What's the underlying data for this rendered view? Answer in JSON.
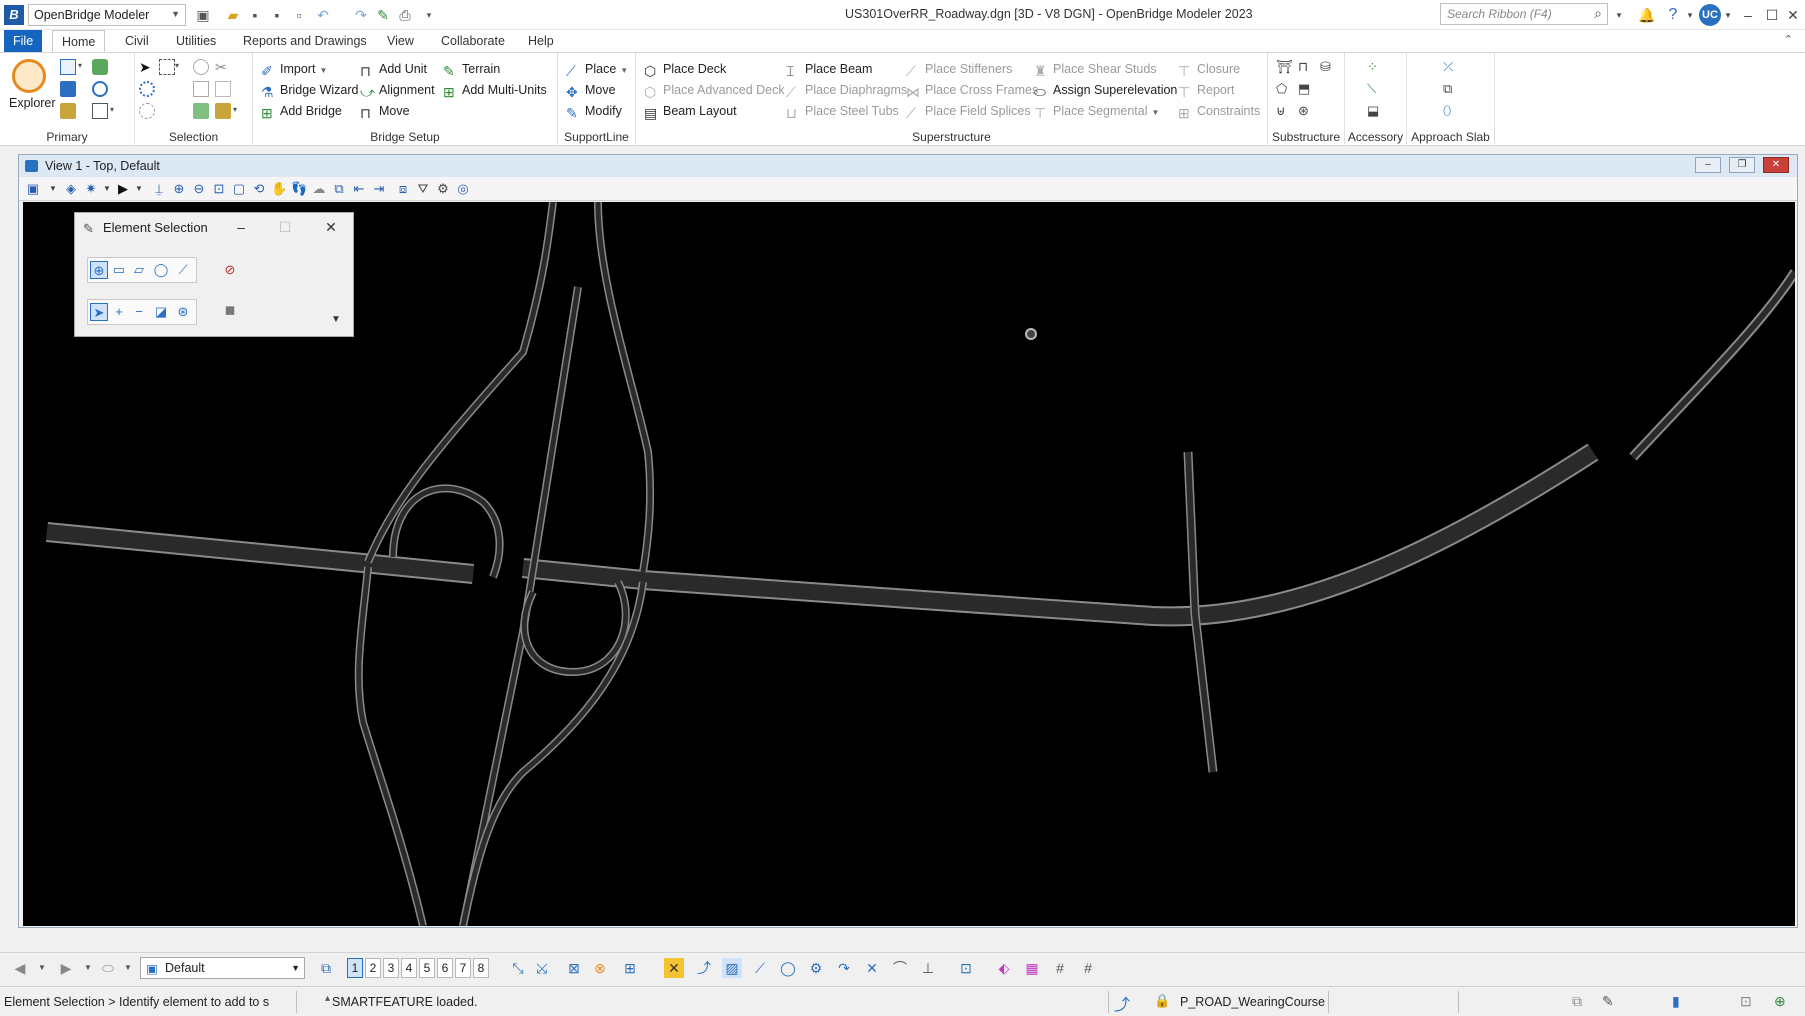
{
  "app": {
    "workflow": "OpenBridge Modeler",
    "document_title": "US301OverRR_Roadway.dgn [3D - V8 DGN] - OpenBridge Modeler 2023",
    "search_placeholder": "Search Ribbon (F4)",
    "user_initials": "UC"
  },
  "menu": {
    "tabs": [
      "File",
      "Home",
      "Civil",
      "Utilities",
      "Reports and Drawings",
      "View",
      "Collaborate",
      "Help"
    ],
    "active_tab": "Home"
  },
  "ribbon": {
    "primary": {
      "label": "Primary",
      "explorer": "Explorer"
    },
    "selection": {
      "label": "Selection"
    },
    "bridge_setup": {
      "label": "Bridge Setup",
      "import": "Import",
      "bridge_wizard": "Bridge Wizard",
      "add_bridge": "Add Bridge",
      "add_unit": "Add Unit",
      "alignment": "Alignment",
      "move": "Move",
      "terrain": "Terrain",
      "add_multi_units": "Add Multi-Units"
    },
    "supportline": {
      "label": "SupportLine",
      "place": "Place",
      "move": "Move",
      "modify": "Modify"
    },
    "superstructure": {
      "label": "Superstructure",
      "place_deck": "Place Deck",
      "place_advanced_deck": "Place Advanced Deck",
      "beam_layout": "Beam Layout",
      "place_beam": "Place Beam",
      "place_diaphragms": "Place Diaphragms",
      "place_steel_tubs": "Place Steel Tubs",
      "place_stiffeners": "Place Stiffeners",
      "place_cross_frames": "Place Cross Frames",
      "place_field_splices": "Place Field Splices",
      "place_shear_studs": "Place Shear Studs",
      "assign_superelevation": "Assign Superelevation",
      "place_segmental": "Place Segmental",
      "closure": "Closure",
      "report": "Report",
      "constraints": "Constraints"
    },
    "substructure": {
      "label": "Substructure"
    },
    "accessory": {
      "label": "Accessory"
    },
    "approach_slab": {
      "label": "Approach Slab"
    }
  },
  "view": {
    "title": "View 1 - Top, Default"
  },
  "element_selection": {
    "title": "Element Selection"
  },
  "bottom": {
    "view_group": "Default",
    "view_numbers": [
      "1",
      "2",
      "3",
      "4",
      "5",
      "6",
      "7",
      "8"
    ],
    "active_view": "1"
  },
  "status": {
    "prompt": "Element Selection > Identify element to add to s",
    "message": "SMARTFEATURE loaded.",
    "active_level": "P_ROAD_WearingCourse"
  },
  "colors": {
    "accent": "#1565c0",
    "canvas_bg": "#000000",
    "road_fill": "#2a2a2a",
    "road_edge": "#8a8a8a"
  }
}
